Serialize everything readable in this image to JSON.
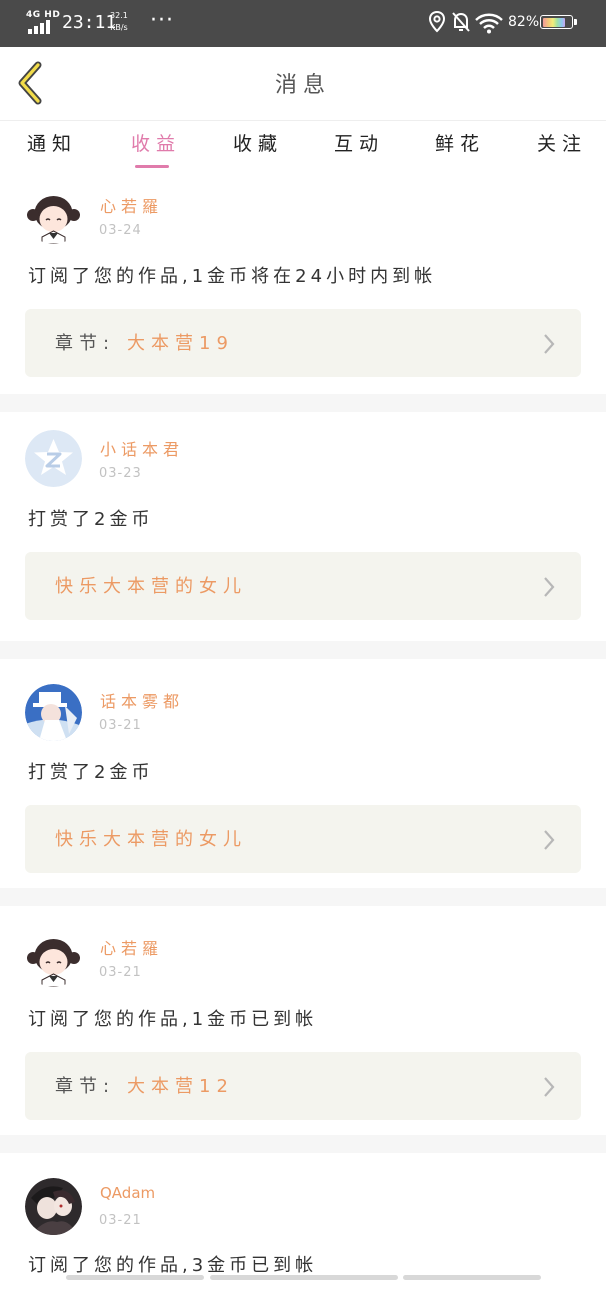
{
  "status_bar": {
    "network": "4G HD",
    "time": "23:11",
    "speed_value": "32.1",
    "speed_unit": "KB/s",
    "more": "···",
    "location_icon": "location-pin-icon",
    "mute_icon": "bell-off-icon",
    "wifi_icon": "wifi-icon",
    "battery_percent": "82%",
    "battery_level": 0.82
  },
  "header": {
    "back_icon": "chevron-left-icon",
    "title": "消息"
  },
  "tabs": [
    {
      "label": "通知",
      "active": false
    },
    {
      "label": "收益",
      "active": true
    },
    {
      "label": "收藏",
      "active": false
    },
    {
      "label": "互动",
      "active": false
    },
    {
      "label": "鲜花",
      "active": false
    },
    {
      "label": "关注",
      "active": false
    }
  ],
  "colors": {
    "accent_pink": "#e07bab",
    "name_orange": "#ec9a64",
    "card_bg": "#f4f4ee",
    "separator": "#f6f6f6"
  },
  "messages": [
    {
      "avatar_icon": "cartoon-girl-avatar",
      "name": "心若羅",
      "date": "03-24",
      "text": "订阅了您的作品,1金币将在24小时内到帐",
      "ref_label": "章节:",
      "ref_value": "大本营19"
    },
    {
      "avatar_icon": "default-z-avatar",
      "name": "小话本君",
      "date": "03-23",
      "text": "打赏了2金币",
      "ref_label": "",
      "ref_value": "快乐大本营的女儿"
    },
    {
      "avatar_icon": "anime-magician-avatar",
      "name": "话本雾都",
      "date": "03-21",
      "text": "打赏了2金币",
      "ref_label": "",
      "ref_value": "快乐大本营的女儿"
    },
    {
      "avatar_icon": "cartoon-girl-avatar",
      "name": "心若羅",
      "date": "03-21",
      "text": "订阅了您的作品,1金币已到帐",
      "ref_label": "章节:",
      "ref_value": "大本营12"
    },
    {
      "avatar_icon": "anime-couple-avatar",
      "name": "QAdam",
      "date": "03-21",
      "text": "订阅了您的作品,3金币已到帐",
      "ref_label": "",
      "ref_value": ""
    }
  ]
}
